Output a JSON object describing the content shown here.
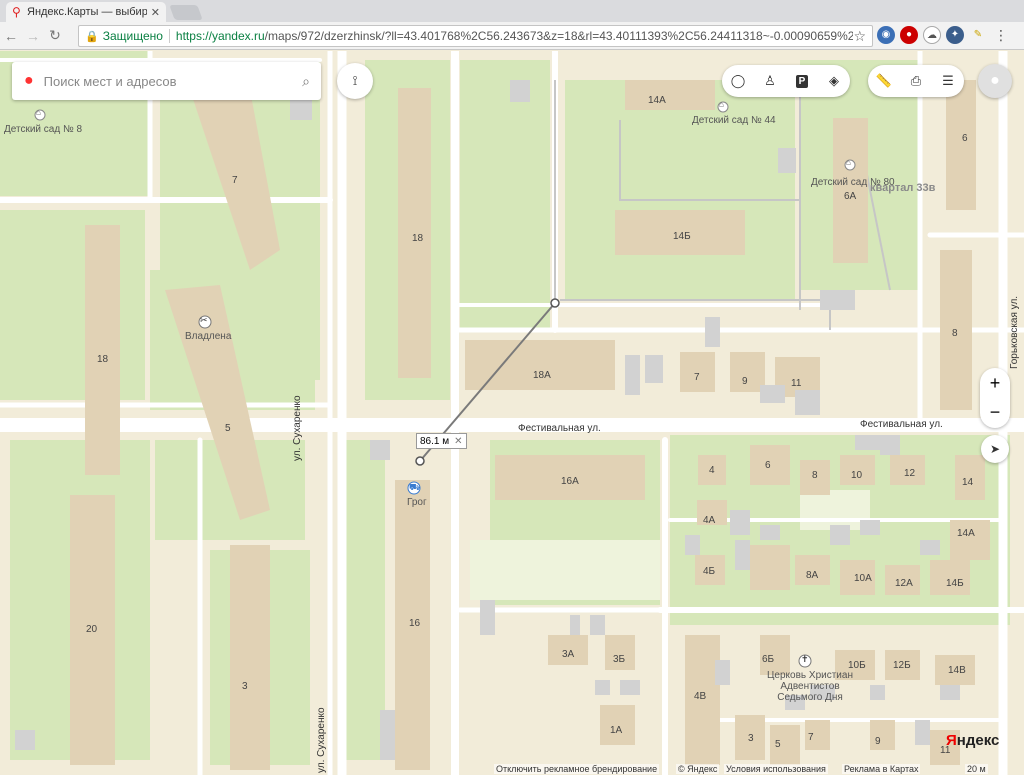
{
  "browser": {
    "tab_title": "Яндекс.Карты — выбирай",
    "secure_label": "Защищено",
    "url_host": "https://yandex.ru",
    "url_rest": "/maps/972/dzerzhinsk/?ll=43.401768%2C56.243673&z=18&rl=43.40111393%2C56.24411318~-0.00090659%2C-0.0..."
  },
  "search": {
    "placeholder": "Поиск мест и адресов"
  },
  "ruler": {
    "distance": "86.1 м"
  },
  "labels": {
    "kindergarten_8": "Детский сад № 8",
    "kindergarten_44": "Детский сад № 44",
    "kindergarten_80": "Детский сад № 80",
    "district": "квартал 33в",
    "vladlena": "Владлена",
    "grog": "Грог",
    "church": "Церковь Христиан Адвентистов Седьмого Дня"
  },
  "streets": {
    "festivalnaya_1": "Фестивальная ул.",
    "festivalnaya_2": "Фестивальная ул.",
    "sukharenko_1": "ул. Сухаренко",
    "sukharenko_2": "ул. Сухаренко",
    "gorkovskaya": "Горьковская ул."
  },
  "buildings": {
    "b14a": "14А",
    "b6": "6",
    "b7": "7",
    "b18": "18",
    "b14b": "14Б",
    "b6a": "6А",
    "b8": "8",
    "b18l": "18",
    "b5": "5",
    "b18a": "18А",
    "b7r": "7",
    "b9": "9",
    "b11": "11",
    "b4": "4",
    "b6r": "6",
    "b8r": "8",
    "b10": "10",
    "b12": "12",
    "b14": "14",
    "b16a": "16А",
    "b4a": "4А",
    "b14ar": "14А",
    "b4b": "4Б",
    "b8a": "8А",
    "b10a": "10А",
    "b12a": "12А",
    "b14br": "14Б",
    "b20": "20",
    "b16": "16",
    "b3a": "3А",
    "b3b": "3Б",
    "b6b": "6Б",
    "b10b": "10Б",
    "b12b": "12Б",
    "b14v": "14В",
    "b3": "3",
    "b4v": "4В",
    "b1a": "1А",
    "b3r": "3",
    "b5r": "5",
    "b7b": "7",
    "b9b": "9",
    "b11b": "11"
  },
  "footer": {
    "branding": "Отключить рекламное брендирование",
    "copyright": "© Яндекс",
    "terms": "Условия использования",
    "ads": "Реклама в Картах",
    "scale": "20 м"
  },
  "logo": {
    "first": "Я",
    "rest": "ндекс"
  },
  "colors": {
    "map_bg": "#f2ecd9",
    "green": "#d5e8b8",
    "building": "#e2d3b6",
    "road": "#ffffff"
  }
}
